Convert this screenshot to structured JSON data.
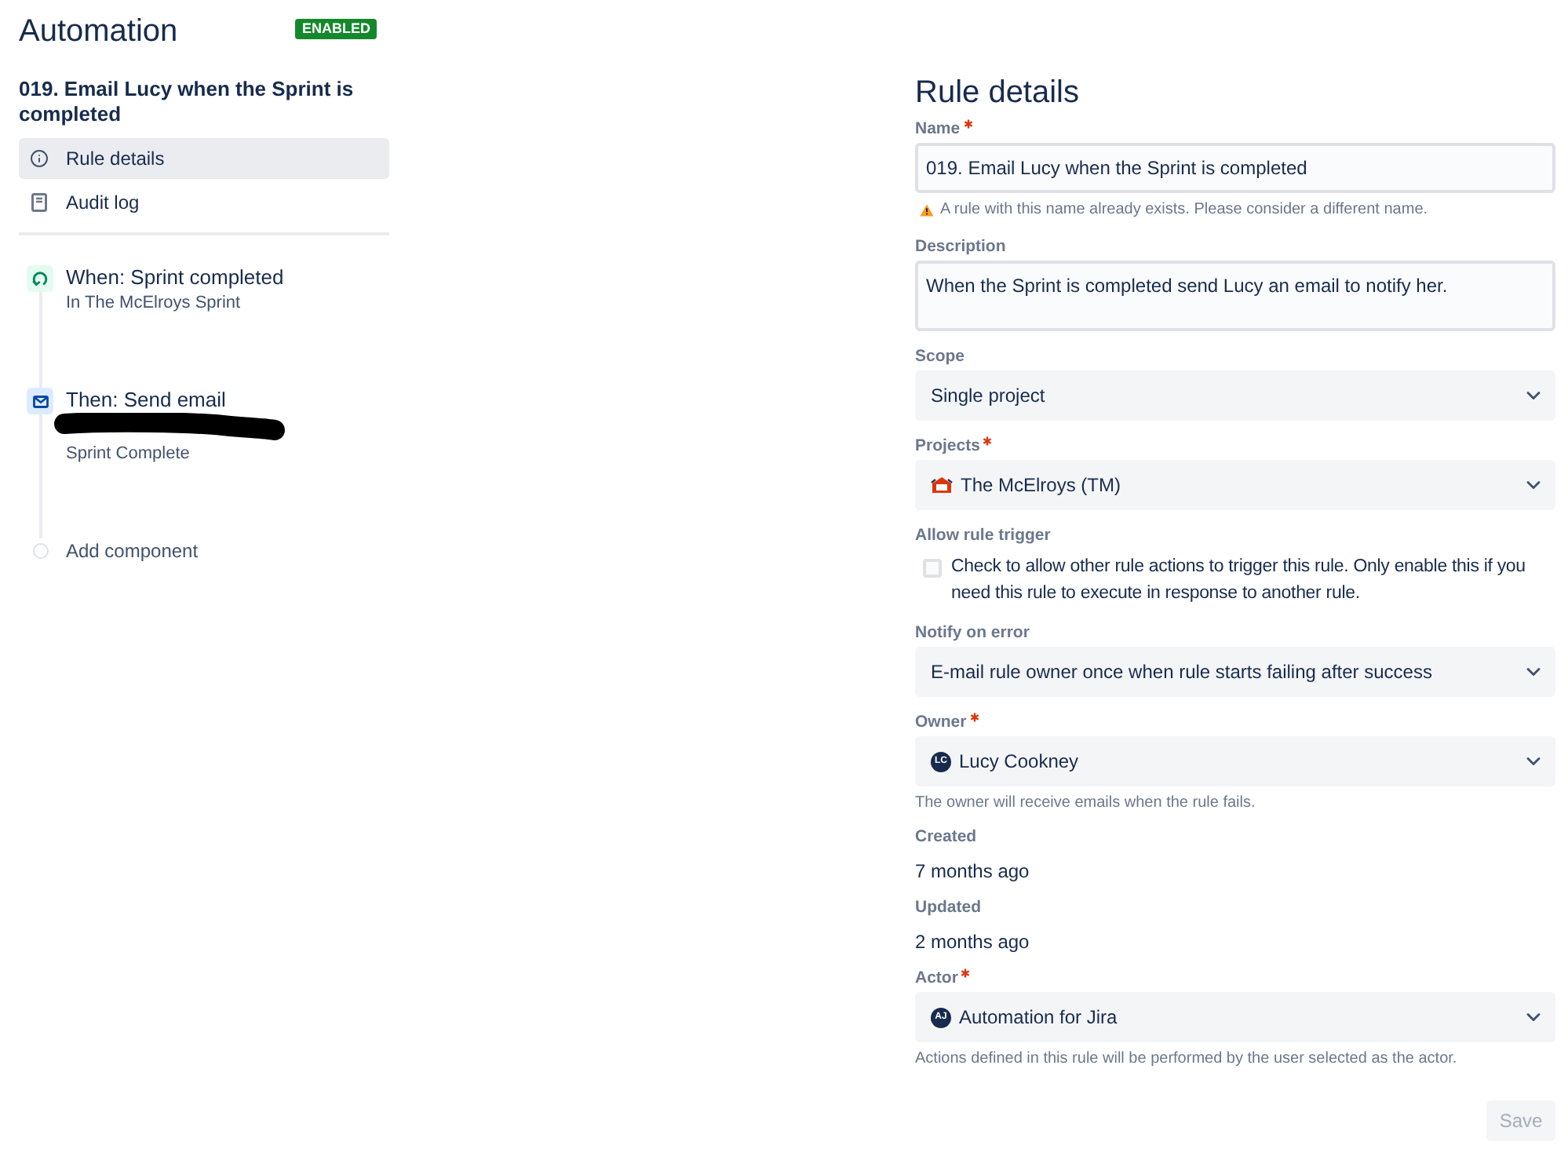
{
  "header": {
    "title": "Automation",
    "status_badge": "ENABLED"
  },
  "rule_name": "019. Email Lucy when the Sprint is completed",
  "nav": [
    {
      "kind": "details",
      "label": "Rule details",
      "selected": true
    },
    {
      "kind": "audit",
      "label": "Audit log",
      "selected": false
    }
  ],
  "components": [
    {
      "kind": "trigger",
      "title": "When: Sprint completed",
      "subtitle": "In The McElroys Sprint",
      "redacted": false
    },
    {
      "kind": "action",
      "title": "Then: Send email",
      "subtitle": "Sprint Complete",
      "redacted": true
    },
    {
      "kind": "add",
      "title": "Add component"
    }
  ],
  "details": {
    "title": "Rule details",
    "fields": [
      {
        "kind": "text",
        "label": "Name",
        "required": true,
        "value": "019. Email Lucy when the Sprint is completed",
        "warning": "A rule with this name already exists. Please consider a different name."
      },
      {
        "kind": "textarea",
        "label": "Description",
        "required": false,
        "value": "When the Sprint is completed send Lucy an email to notify her."
      },
      {
        "kind": "select",
        "label": "Scope",
        "required": false,
        "value": "Single project"
      },
      {
        "kind": "select",
        "label": "Projects",
        "required": true,
        "value": "The McElroys (TM)",
        "avatar": {
          "kind": "project"
        }
      },
      {
        "kind": "checkbox",
        "label": "Allow rule trigger",
        "required": false,
        "checked": false,
        "text": "Check to allow other rule actions to trigger this rule. Only enable this if you need this rule to execute in response to another rule."
      },
      {
        "kind": "select",
        "label": "Notify on error",
        "required": false,
        "value": "E-mail rule owner once when rule starts failing after success"
      },
      {
        "kind": "select",
        "label": "Owner",
        "required": true,
        "value": "Lucy Cookney",
        "avatar": {
          "kind": "user",
          "initials": "LC"
        },
        "hint": "The owner will receive emails when the rule fails."
      },
      {
        "kind": "static",
        "label": "Created",
        "required": false,
        "value": "7 months ago"
      },
      {
        "kind": "static",
        "label": "Updated",
        "required": false,
        "value": "2 months ago"
      },
      {
        "kind": "select",
        "label": "Actor",
        "required": true,
        "value": "Automation for Jira",
        "avatar": {
          "kind": "user",
          "initials": "AJ"
        },
        "hint": "Actions defined in this rule will be performed by the user selected as the actor."
      }
    ],
    "save_button": {
      "label": "Save",
      "disabled": true
    }
  }
}
